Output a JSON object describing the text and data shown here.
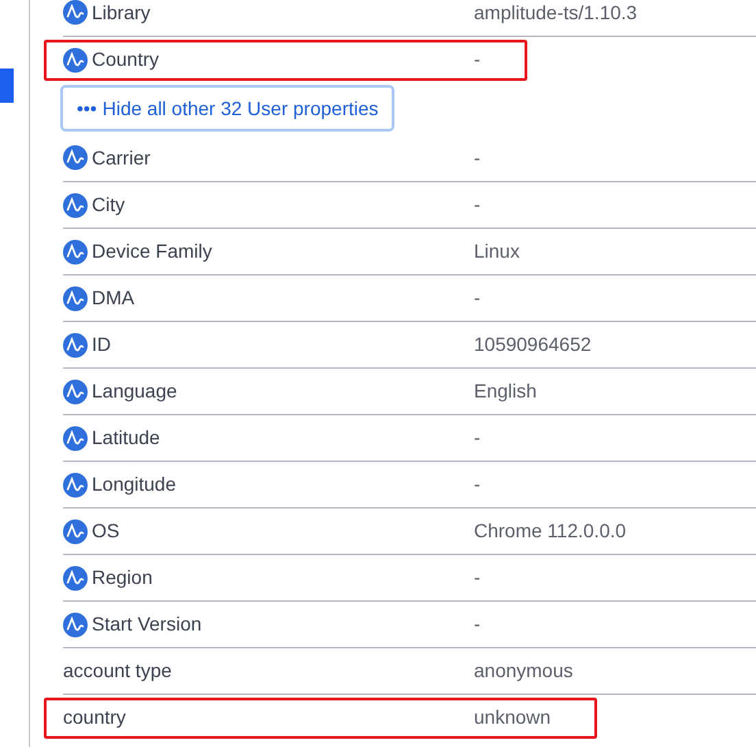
{
  "top_rows": [
    {
      "label": "Library",
      "value": "amplitude-ts/1.10.3",
      "kind": "default",
      "highlighted": false
    },
    {
      "label": "Country",
      "value": "-",
      "kind": "default",
      "highlighted": true
    }
  ],
  "toggle": {
    "icon": "•••",
    "label": "Hide all other 32 User properties"
  },
  "rows": [
    {
      "label": "Carrier",
      "value": "-",
      "kind": "default",
      "highlighted": false
    },
    {
      "label": "City",
      "value": "-",
      "kind": "default",
      "highlighted": false
    },
    {
      "label": "Device Family",
      "value": "Linux",
      "kind": "default",
      "highlighted": false
    },
    {
      "label": "DMA",
      "value": "-",
      "kind": "default",
      "highlighted": false
    },
    {
      "label": "ID",
      "value": "10590964652",
      "kind": "default",
      "highlighted": false
    },
    {
      "label": "Language",
      "value": "English",
      "kind": "default",
      "highlighted": false
    },
    {
      "label": "Latitude",
      "value": "-",
      "kind": "default",
      "highlighted": false
    },
    {
      "label": "Longitude",
      "value": "-",
      "kind": "default",
      "highlighted": false
    },
    {
      "label": "OS",
      "value": "Chrome 112.0.0.0",
      "kind": "default",
      "highlighted": false
    },
    {
      "label": "Region",
      "value": "-",
      "kind": "default",
      "highlighted": false
    },
    {
      "label": "Start Version",
      "value": "-",
      "kind": "default",
      "highlighted": false
    },
    {
      "label": "account type",
      "value": "anonymous",
      "kind": "custom",
      "highlighted": false
    },
    {
      "label": "country",
      "value": "unknown",
      "kind": "custom",
      "highlighted": true
    }
  ]
}
